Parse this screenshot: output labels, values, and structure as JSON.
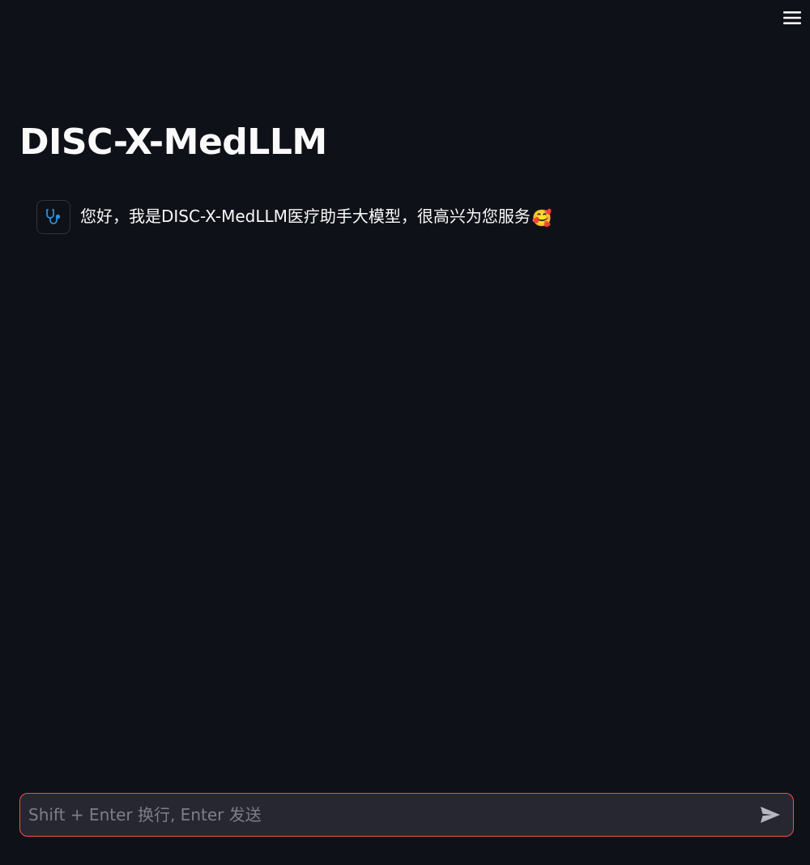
{
  "app": {
    "title": "DISC-X-MedLLM"
  },
  "header": {
    "menu_icon": "hamburger-menu-icon"
  },
  "chat": {
    "messages": [
      {
        "role": "assistant",
        "avatar_icon": "stethoscope-icon",
        "text": "您好，我是DISC-X-MedLLM医疗助手大模型，很高兴为您服务",
        "emoji": "🥰"
      }
    ]
  },
  "input": {
    "placeholder": "Shift + Enter 换行, Enter 发送",
    "value": "",
    "send_icon": "send-icon"
  },
  "colors": {
    "background": "#0e1117",
    "text": "#fafafa",
    "input_background": "#262730",
    "input_border_focus": "#ff4b4b",
    "avatar_icon": "#2b8fd6",
    "placeholder": "#7d7f88"
  }
}
